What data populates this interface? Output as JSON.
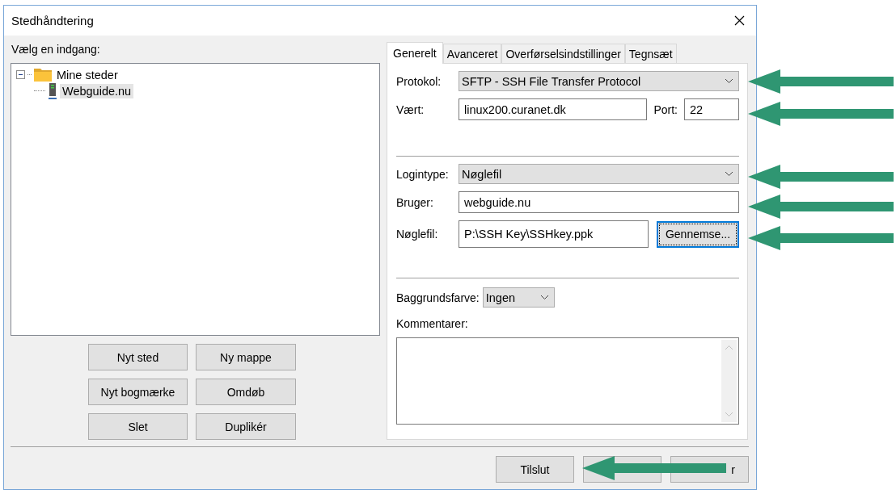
{
  "window": {
    "title": "Stedhåndtering"
  },
  "site_tree": {
    "label": "Vælg en indgang:",
    "items": [
      {
        "label": "Mine steder",
        "kind": "folder",
        "expanded": true,
        "selected": false,
        "children": [
          {
            "label": "Webguide.nu",
            "kind": "server",
            "selected": true
          }
        ]
      }
    ]
  },
  "tree_buttons": [
    "Nyt sted",
    "Ny mappe",
    "Nyt bogmærke",
    "Omdøb",
    "Slet",
    "Duplikér"
  ],
  "tabs": [
    {
      "label": "Generelt",
      "selected": true
    },
    {
      "label": "Avanceret",
      "selected": false
    },
    {
      "label": "Overførselsindstillinger",
      "selected": false
    },
    {
      "label": "Tegnsæt",
      "selected": false
    }
  ],
  "general": {
    "protocol": {
      "label": "Protokol:",
      "value": "SFTP - SSH File Transfer Protocol"
    },
    "host": {
      "label": "Vært:",
      "value": "linux200.curanet.dk"
    },
    "port": {
      "label": "Port:",
      "value": "22"
    },
    "logon_type": {
      "label": "Logintype:",
      "value": "Nøglefil"
    },
    "user": {
      "label": "Bruger:",
      "value": "webguide.nu"
    },
    "key_file": {
      "label": "Nøglefil:",
      "value": "P:\\SSH Key\\SSHkey.ppk"
    },
    "browse": {
      "label": "Gennemse...",
      "focused": true
    },
    "background_color": {
      "label": "Baggrundsfarve:",
      "value": "Ingen"
    },
    "comments": {
      "label": "Kommentarer:"
    }
  },
  "footer_buttons": [
    {
      "kind": "plain",
      "label": "Tilslut"
    },
    {
      "kind": "covered"
    },
    {
      "kind": "covered",
      "label": "r"
    }
  ]
}
